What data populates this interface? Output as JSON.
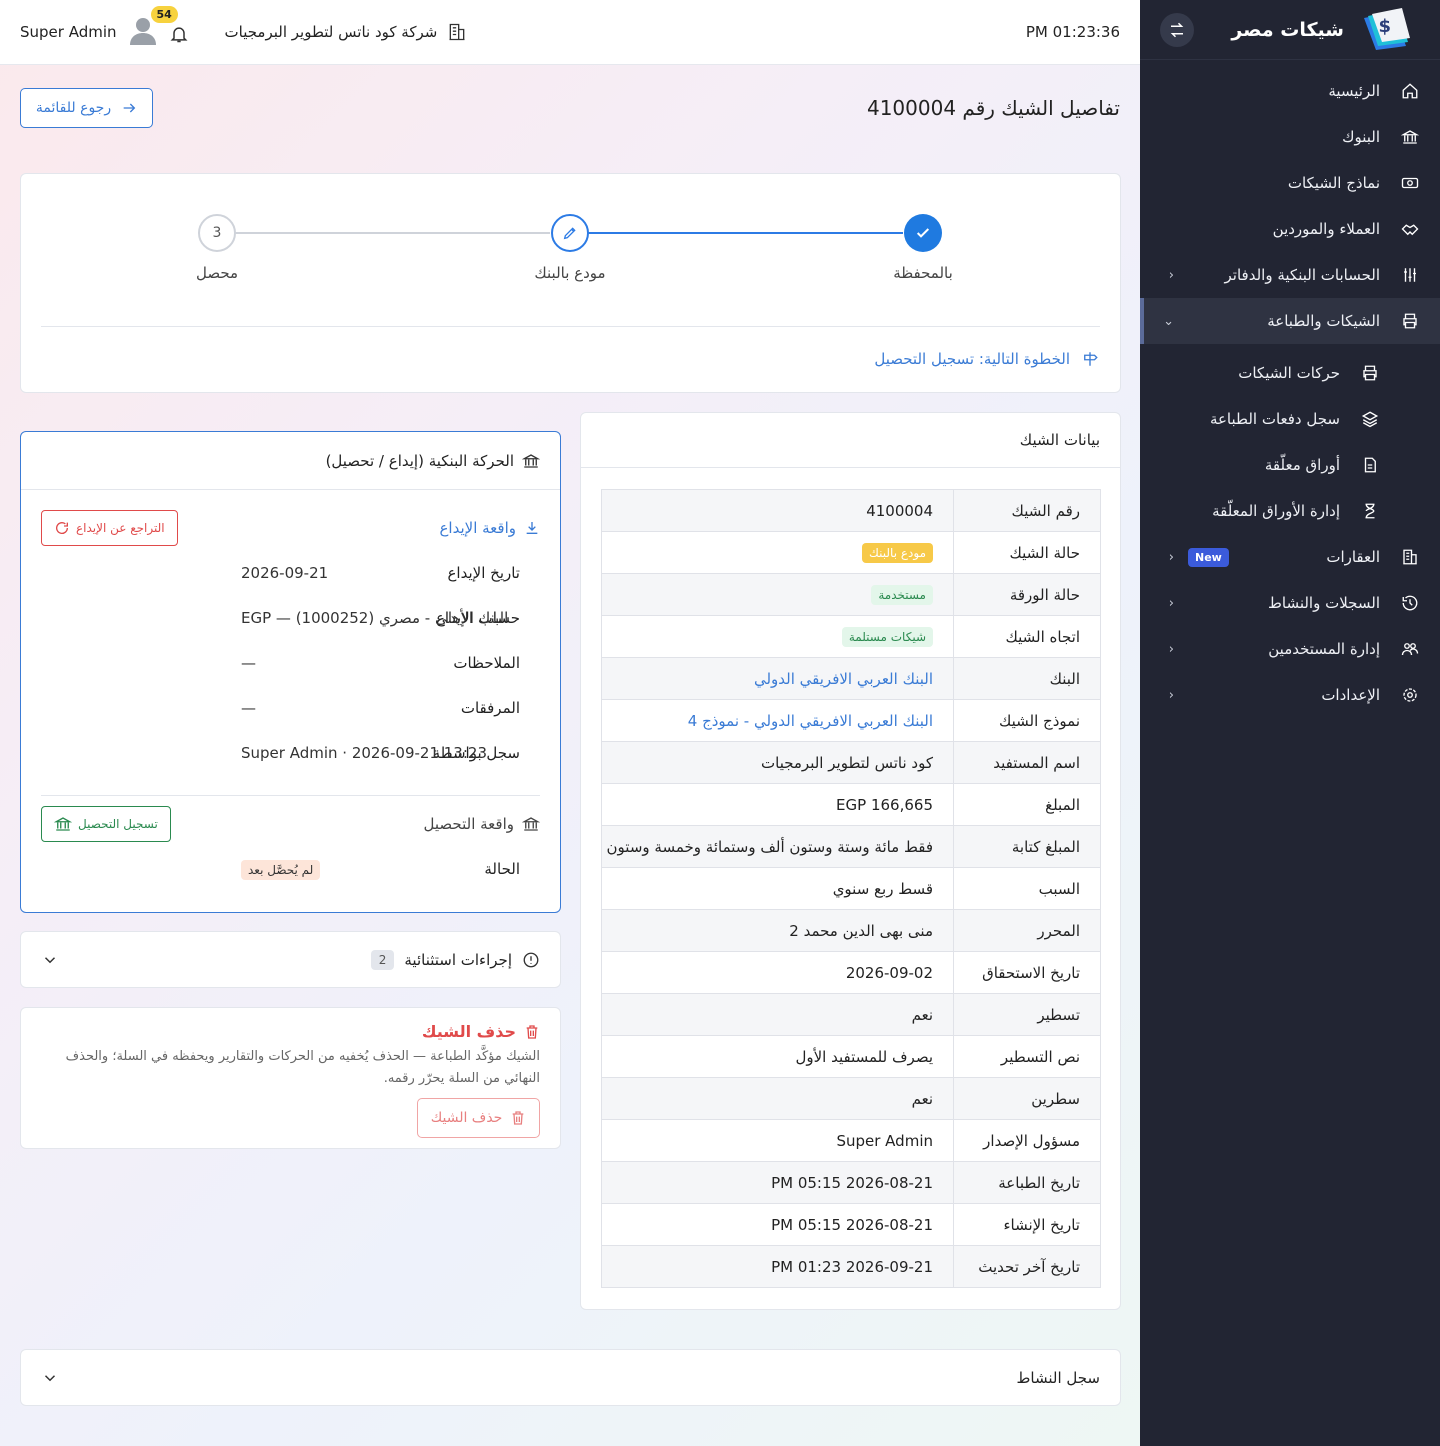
{
  "sidebar": {
    "brand": "شيكات مصر",
    "items": [
      {
        "label": "الرئيسية",
        "icon": "home-icon"
      },
      {
        "label": "البنوك",
        "icon": "bank-icon"
      },
      {
        "label": "نماذج الشيكات",
        "icon": "money-icon"
      },
      {
        "label": "العملاء والموردين",
        "icon": "handshake-icon"
      },
      {
        "label": "الحسابات البنكية والدفاتر",
        "icon": "sliders-icon"
      },
      {
        "label": "الشيكات والطباعة",
        "icon": "printer-icon"
      },
      {
        "label": "العقارات",
        "icon": "building-icon",
        "badge": "New"
      },
      {
        "label": "السجلات والنشاط",
        "icon": "history-icon"
      },
      {
        "label": "إدارة المستخدمين",
        "icon": "users-icon"
      },
      {
        "label": "الإعدادات",
        "icon": "gear-icon"
      }
    ],
    "subitems": [
      {
        "label": "حركات الشيكات"
      },
      {
        "label": "سجل دفعات الطباعة"
      },
      {
        "label": "أوراق معلّقة"
      },
      {
        "label": "إدارة الأوراق المعلّقة"
      }
    ]
  },
  "topbar": {
    "time": "PM 01:23:36",
    "company": "شركة كود ناتس لتطوير البرمجيات",
    "notifications": "54",
    "user": "Super Admin"
  },
  "page": {
    "title": "تفاصيل الشيك رقم 4100004",
    "back": "رجوع للقائمة"
  },
  "stepper": {
    "steps": [
      {
        "label": "بالمحفظة",
        "state": "done"
      },
      {
        "label": "مودع بالبنك",
        "state": "current"
      },
      {
        "label": "محصل",
        "state": "pending",
        "num": "3"
      }
    ],
    "next": "الخطوة التالية: تسجيل التحصيل"
  },
  "details": {
    "title": "بيانات الشيك",
    "rows": [
      {
        "k": "رقم الشيك",
        "v": "4100004"
      },
      {
        "k": "حالة الشيك",
        "v": "مودع بالبنك"
      },
      {
        "k": "حالة الورقة",
        "v": "مستخدمة"
      },
      {
        "k": "اتجاه الشيك",
        "v": "شيكات مستلمة"
      },
      {
        "k": "البنك",
        "v": "البنك العربي الافريقي الدولي"
      },
      {
        "k": "نموذج الشيك",
        "v": "البنك العربي الافريقي الدولي - نموذج 4"
      },
      {
        "k": "اسم المستفيد",
        "v": "كود ناتس لتطوير البرمجيات"
      },
      {
        "k": "المبلغ",
        "v": "EGP 166,665"
      },
      {
        "k": "المبلغ كتابة",
        "v": "فقط مائة وستة وستون ألف وستمائة وخمسة وستون"
      },
      {
        "k": "السبب",
        "v": "قسط ربع سنوي"
      },
      {
        "k": "المحرر",
        "v": "منى بهى الدين محمد 2"
      },
      {
        "k": "تاريخ الاستحقاق",
        "v": "2026-09-02"
      },
      {
        "k": "تسطير",
        "v": "نعم"
      },
      {
        "k": "نص التسطير",
        "v": "يصرف للمستفيد الأول"
      },
      {
        "k": "سطرين",
        "v": "نعم"
      },
      {
        "k": "مسؤول الإصدار",
        "v": "Super Admin"
      },
      {
        "k": "تاريخ الطباعة",
        "v": "PM 05:15 2026-08-21"
      },
      {
        "k": "تاريخ الإنشاء",
        "v": "PM 05:15 2026-08-21"
      },
      {
        "k": "تاريخ آخر تحديث",
        "v": "PM 01:23 2026-09-21"
      }
    ]
  },
  "bank": {
    "title": "الحركة البنكية (إيداع / تحصيل)",
    "deposit_title": "واقعة الإيداع",
    "undo_btn": "التراجع عن الإيداع",
    "rows": [
      {
        "k": "تاريخ الإيداع",
        "v": "2026-09-21"
      },
      {
        "k": "حساب الإيداع",
        "v": "البنك الأهلى - مصري (1000252) — EGP"
      },
      {
        "k": "الملاحظات",
        "v": "—"
      },
      {
        "k": "المرفقات",
        "v": "—"
      },
      {
        "k": "سجل بواسطة",
        "v": "Super Admin · 2026-09-21 13:23"
      }
    ],
    "collect_title": "واقعة التحصيل",
    "collect_btn": "تسجيل التحصيل",
    "status_k": "الحالة",
    "status_v": "لم يُحصَّل بعد"
  },
  "exceptions": {
    "title": "إجراءات استثنائية",
    "count": "2"
  },
  "delete": {
    "title": "حذف الشيك",
    "text": "الشيك مؤكَّد الطباعة — الحذف يُخفيه من الحركات والتقارير ويحفظه في السلة؛ والحذف النهائي من السلة يحرّر رقمه.",
    "btn": "حذف الشيك"
  },
  "activity": {
    "title": "سجل النشاط"
  }
}
